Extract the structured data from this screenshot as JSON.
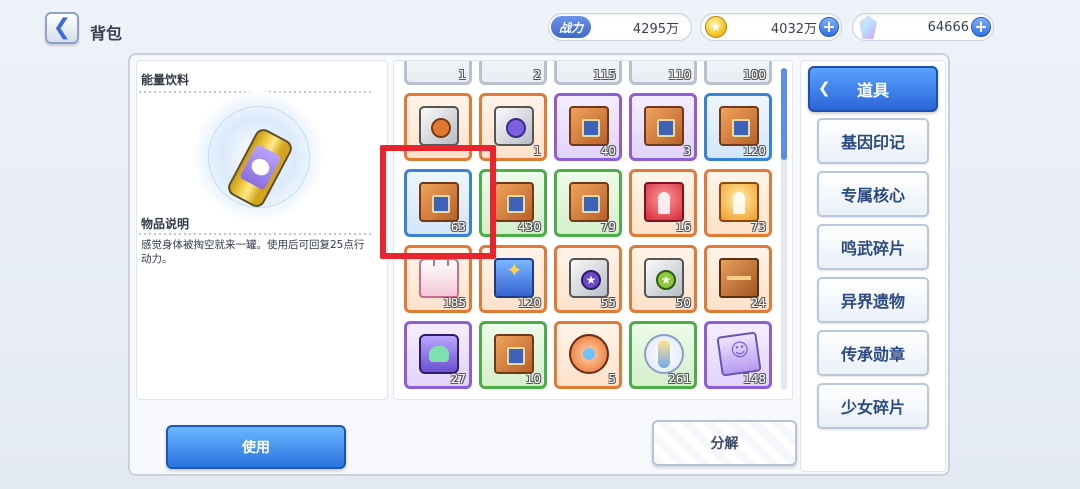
{
  "header": {
    "back_icon": "chevron-left-icon",
    "title": "背包"
  },
  "resources": {
    "power_label": "战力",
    "power_value": "4295万",
    "gold_icon": "coin-icon",
    "gold_value": "4032万",
    "gem_icon": "crystal-icon",
    "gem_value": "64666",
    "plus_label": "+"
  },
  "detail": {
    "item_name": "能量饮料",
    "item_icon": "energy-drink-can-icon",
    "desc_title": "物品说明",
    "desc_text": "感觉身体被掏空就来一罐。使用后可回复25点行动力。"
  },
  "grid": {
    "rows": [
      [
        {
          "icon": "partial",
          "qty": "1",
          "rarity": "white"
        },
        {
          "icon": "partial",
          "qty": "2",
          "rarity": "white"
        },
        {
          "icon": "partial",
          "qty": "115",
          "rarity": "white"
        },
        {
          "icon": "partial",
          "qty": "110",
          "rarity": "white"
        },
        {
          "icon": "partial",
          "qty": "100",
          "rarity": "white"
        }
      ],
      [
        {
          "icon": "i-cube-w",
          "qty": "",
          "rarity": "orange"
        },
        {
          "icon": "i-cube-w i-cube-p",
          "qty": "1",
          "rarity": "orange"
        },
        {
          "icon": "i-box",
          "qty": "40",
          "rarity": "purple"
        },
        {
          "icon": "i-box",
          "qty": "3",
          "rarity": "purple"
        },
        {
          "icon": "i-box",
          "qty": "120",
          "rarity": "blue"
        }
      ],
      [
        {
          "icon": "i-box",
          "qty": "63",
          "rarity": "blue"
        },
        {
          "icon": "i-box",
          "qty": "430",
          "rarity": "green"
        },
        {
          "icon": "i-box",
          "qty": "79",
          "rarity": "green"
        },
        {
          "icon": "i-red",
          "qty": "16",
          "rarity": "orange"
        },
        {
          "icon": "i-gold",
          "qty": "73",
          "rarity": "orange"
        }
      ],
      [
        {
          "icon": "i-bag",
          "qty": "185",
          "rarity": "orange"
        },
        {
          "icon": "i-gift",
          "qty": "120",
          "rarity": "orange"
        },
        {
          "icon": "i-cube-w i-cube-star",
          "qty": "55",
          "rarity": "orange"
        },
        {
          "icon": "i-cube-w i-cube-gstar",
          "qty": "50",
          "rarity": "orange"
        },
        {
          "icon": "i-crate",
          "qty": "24",
          "rarity": "orange"
        }
      ],
      [
        {
          "icon": "i-frog",
          "qty": "27",
          "rarity": "purple"
        },
        {
          "icon": "i-box",
          "qty": "10",
          "rarity": "green"
        },
        {
          "icon": "i-disc",
          "qty": "5",
          "rarity": "orange"
        },
        {
          "icon": "i-spirit",
          "qty": "261",
          "rarity": "green"
        },
        {
          "icon": "i-ticket",
          "qty": "148",
          "rarity": "purple"
        }
      ]
    ]
  },
  "categories": {
    "active": "道具",
    "items": [
      "基因印记",
      "专属核心",
      "鸣武碎片",
      "异界遗物",
      "传承勋章",
      "少女碎片"
    ]
  },
  "actions": {
    "use_label": "使用",
    "split_label": "分解"
  },
  "colors": {
    "accent": "#2a66d8",
    "highlight": "#e8242f"
  }
}
